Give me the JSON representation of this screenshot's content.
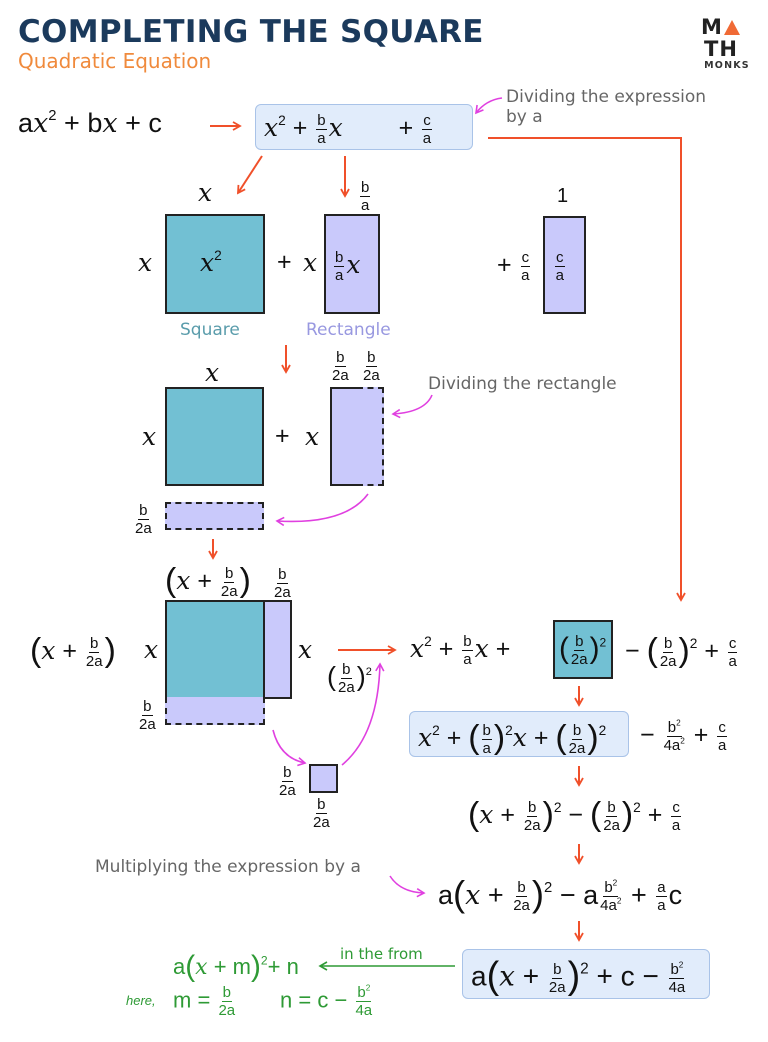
{
  "header": {
    "title": "COMPLETING THE SQUARE",
    "subtitle": "Quadratic Equation"
  },
  "logo": {
    "top_left": "M",
    "top_right": "TH",
    "bottom": "MONKS",
    "accent_color": "#f06a35"
  },
  "colors": {
    "square_fill": "#72c0d3",
    "rectangle_fill": "#c9c9fb",
    "highlight_box": "#e1ecfb",
    "arrow_red": "#f0502a",
    "arrow_magenta": "#e040e0",
    "note_gray": "#666666",
    "form_green": "#2e9a35",
    "title_navy": "#1b3a5c",
    "subtitle_orange": "#f08a3c"
  },
  "symbols": {
    "x": "x",
    "plus": "+",
    "minus": "−",
    "equals": "=",
    "two": "2",
    "one": "1",
    "b": "b",
    "a": "a",
    "c": "c",
    "two_a": "2a",
    "four_a": "4a",
    "lparen": "(",
    "rparen": ")",
    "right_arrow": "→",
    "m": "m",
    "n": "n"
  },
  "step1": {
    "original": {
      "a": "a",
      "b": "b",
      "c": "c"
    },
    "note_dividing_expression": [
      "Dividing the expression",
      "by a"
    ]
  },
  "step2": {
    "square_label": "Square",
    "rectangle_label": "Rectangle",
    "unit_side": "1"
  },
  "step3": {
    "note_dividing_rectangle": "Dividing the rectangle"
  },
  "step5": {
    "note_multiplying": "Multiplying the expression by a"
  },
  "final": {
    "arrow_label": "in the from",
    "general_form": {
      "a": "a",
      "m": "m",
      "n": "n"
    },
    "here_label": "here,"
  }
}
